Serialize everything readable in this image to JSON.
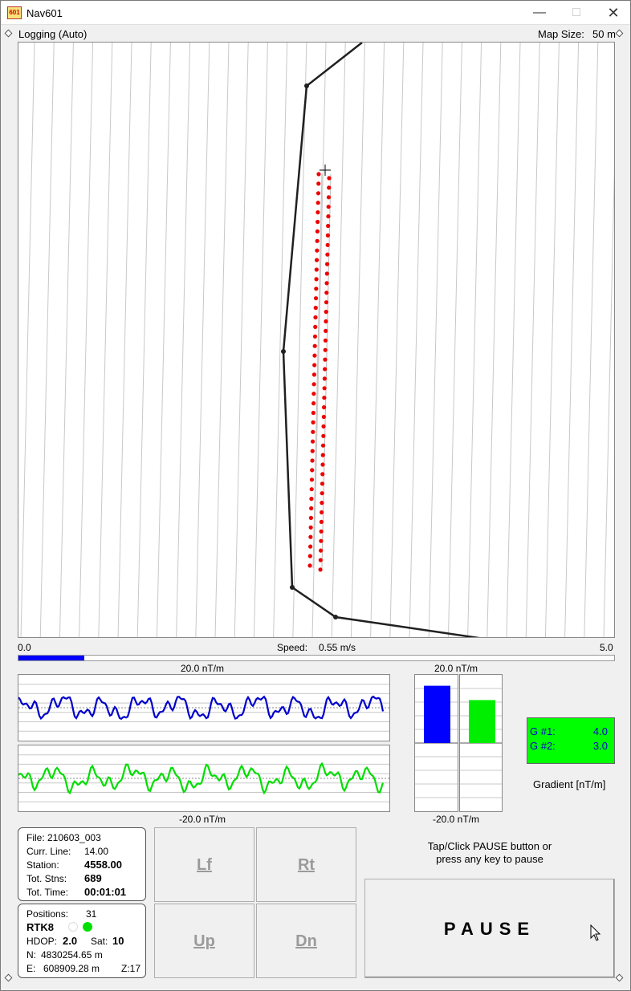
{
  "window": {
    "title": "Nav601",
    "icon": "601",
    "min_icon": "minimize-icon",
    "max_icon": "maximize-icon",
    "close_icon": "close-icon"
  },
  "header": {
    "mode": "Logging (Auto)",
    "map_size_label": "Map Size:",
    "map_size_value": "50 m"
  },
  "speed": {
    "min": "0.0",
    "max": "5.0",
    "label": "Speed:",
    "value": "0.55 m/s",
    "fraction": 0.11
  },
  "traces": {
    "top_label": "20.0 nT/m",
    "bottom_label": "-20.0 nT/m",
    "g1_color": "#0000cc",
    "g2_color": "#00dd00"
  },
  "bars": {
    "top_label": "20.0 nT/m",
    "bottom_label": "-20.0 nT/m",
    "g1_value": 4.0,
    "g2_value": 3.0,
    "range": [
      -20,
      20
    ]
  },
  "gradient": {
    "g1_label": "G #1:",
    "g1_value": "4.0",
    "g2_label": "G #2:",
    "g2_value": "3.0",
    "caption": "Gradient [nT/m]"
  },
  "file_info": {
    "file": "File: 210603_003",
    "curr_line_label": "Curr. Line:",
    "curr_line_value": "14.00",
    "station_label": "Station:",
    "station_value": "4558.00",
    "tot_stns_label": "Tot. Stns:",
    "tot_stns_value": "689",
    "tot_time_label": "Tot. Time:",
    "tot_time_value": "00:01:01"
  },
  "gps_info": {
    "positions_label": "Positions:",
    "positions_value": "31",
    "mode": "RTK8",
    "hdop_label": "HDOP:",
    "hdop_value": "2.0",
    "sat_label": "Sat:",
    "sat_value": "10",
    "n_label": "N:",
    "n_value": "4830254.65 m",
    "e_label": "E:",
    "e_value": "608909.28 m",
    "zone": "Z:17"
  },
  "nav_buttons": {
    "lf": "Lf",
    "rt": "Rt",
    "up": "Up",
    "dn": "Dn"
  },
  "pause": {
    "hint_line1": "Tap/Click PAUSE button or",
    "hint_line2": "press any key to pause",
    "label": "PAUSE"
  }
}
